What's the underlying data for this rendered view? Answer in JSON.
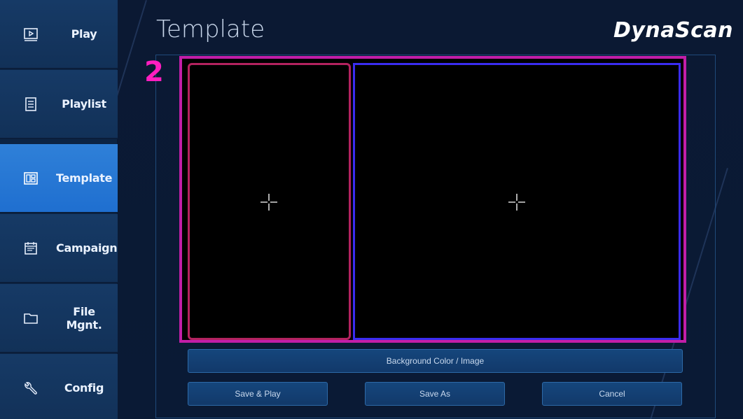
{
  "sidebar": {
    "items": [
      {
        "label": "Play",
        "icon": "play-icon"
      },
      {
        "label": "Playlist",
        "icon": "playlist-icon"
      },
      {
        "label": "Template",
        "icon": "template-icon",
        "active": true
      },
      {
        "label": "Campaign",
        "icon": "campaign-icon"
      },
      {
        "label": "File Mgnt.",
        "icon": "folder-icon"
      },
      {
        "label": "Config",
        "icon": "wrench-icon"
      }
    ]
  },
  "header": {
    "title": "Template",
    "brand": "DynaScan"
  },
  "editor": {
    "step_badge": "2",
    "zones": [
      {
        "name": "zone-left",
        "border_color": "#b3225f"
      },
      {
        "name": "zone-right",
        "border_color": "#3a2cf0"
      }
    ]
  },
  "actions": {
    "background_label": "Background Color / Image",
    "save_play_label": "Save & Play",
    "save_as_label": "Save As",
    "cancel_label": "Cancel"
  },
  "colors": {
    "accent_active": "#1f6fd0",
    "frame_highlight": "#c21ea8",
    "badge": "#ff1ec0"
  }
}
